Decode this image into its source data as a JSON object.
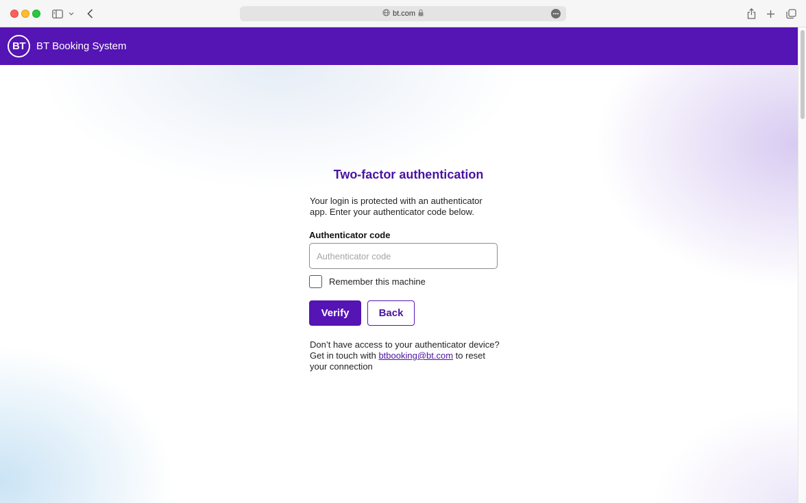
{
  "browser": {
    "url": "bt.com"
  },
  "header": {
    "logo_text": "BT",
    "app_title": "BT Booking System"
  },
  "login": {
    "title": "Two-factor authentication",
    "intro": "Your login is protected with an authenticator app. Enter your authenticator code below.",
    "code_label": "Authenticator code",
    "code_placeholder": "Authenticator code",
    "code_value": "",
    "remember_label": "Remember this machine",
    "remember_checked": false,
    "verify_label": "Verify",
    "back_label": "Back",
    "help_prefix": "Don’t have access to your authenticator device? Get in touch with ",
    "help_email": "btbooking@bt.com",
    "help_suffix": " to reset your connection"
  },
  "colors": {
    "brand_purple": "#5514b4",
    "title_purple": "#4a13a0"
  },
  "icons": [
    "sidebar-icon",
    "chevron-down-icon",
    "back-arrow-icon",
    "globe-icon",
    "lock-icon",
    "more-icon",
    "share-icon",
    "plus-icon",
    "tabs-icon"
  ]
}
